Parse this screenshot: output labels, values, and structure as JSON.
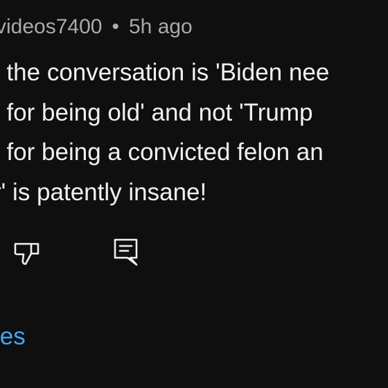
{
  "comment": {
    "author": "videos7400",
    "separator": "•",
    "timestamp": "5h ago",
    "lines": [
      "t the conversation is 'Biden nee",
      "t for being old' and not 'Trump",
      "t for being a convicted felon an",
      "r' is patently insane!"
    ]
  },
  "actions": {
    "dislike_icon": "thumbs-down-icon",
    "reply_icon": "reply-comment-icon"
  },
  "replies_label": "ies",
  "colors": {
    "background": "#0f0f0f",
    "text": "#f1f1f1",
    "meta": "#aaaaaa",
    "link": "#3ea6ff"
  }
}
